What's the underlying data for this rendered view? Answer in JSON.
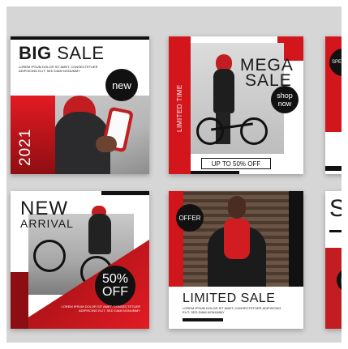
{
  "posts": {
    "big_sale": {
      "title_bold": "BIG",
      "title_rest": " SALE",
      "lorem": "LOREM IPSUM DOLOR SIT AMET, CONSECTETUER ADIPISCING ELIT, SED DIAM NONUMMY",
      "badge": "new",
      "year": "2021"
    },
    "mega_sale": {
      "title_line1": "MEGA",
      "title_line2": "SALE",
      "vertical_text": "LIMITED TIME",
      "badge": "shop now",
      "offer": "UP TO 50% OFF"
    },
    "special_offer_partial": {
      "badge": "SPE OF"
    },
    "new_arrival": {
      "title_line1": "NEW",
      "title_line2": "ARRIVAL",
      "badge": "50% OFF",
      "lorem": "LOREM IPSUM DOLOR SIT AMET, CONSECTETUER ADIPISCING ELIT, SED DIAM NONUMMY"
    },
    "limited_sale": {
      "badge": "OFFER",
      "title": "LIMITED SALE",
      "lorem": "LOREM IPSUM DOLOR SIT AMET, CONSECTETUER ADIPISCING ELIT, SED DIAM NONUMMY"
    },
    "partial_right": {
      "letter": "S",
      "badge": "n"
    }
  },
  "colors": {
    "accent_red": "#d3161c",
    "dark_red": "#8e0e12",
    "black": "#111111",
    "background": "#d6d6d6"
  }
}
